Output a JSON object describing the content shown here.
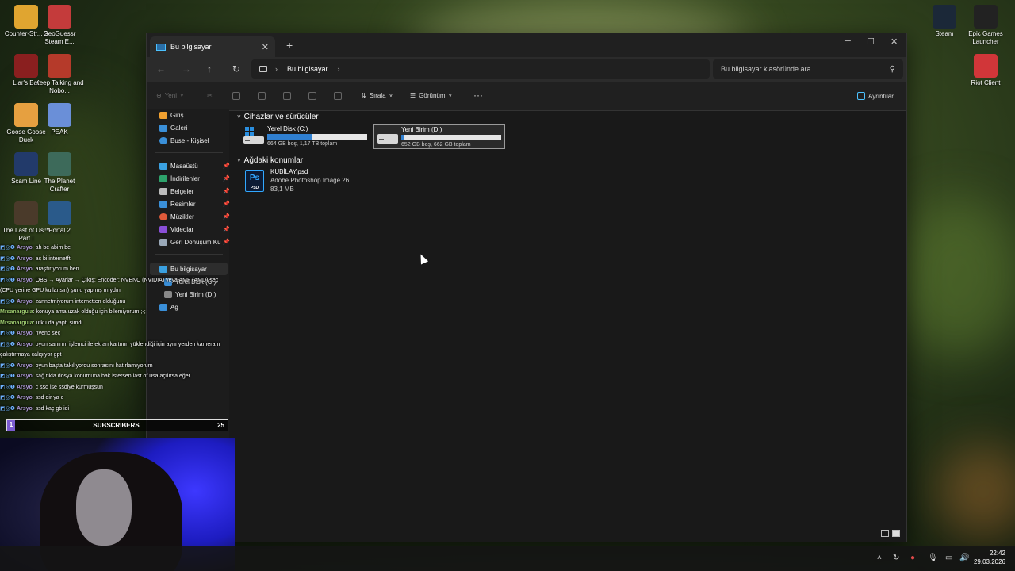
{
  "desktop": {
    "left_icons": [
      {
        "label": "Counter-Str... 2",
        "icon": "cs2-icon",
        "color": "#e0a530"
      },
      {
        "label": "GeoGuessr Steam E...",
        "icon": "geoguessr-icon",
        "color": "#c43b3b"
      },
      {
        "label": "Liar's Bar",
        "icon": "liars-bar-icon",
        "color": "#8a1f1f"
      },
      {
        "label": "Keep Talking and Nobo...",
        "icon": "keep-talking-icon",
        "color": "#b53a2a"
      },
      {
        "label": "Goose Goose Duck",
        "icon": "goose-goose-duck-icon",
        "color": "#e6a040"
      },
      {
        "label": "PEAK",
        "icon": "peak-icon",
        "color": "#6a8fd8"
      },
      {
        "label": "Scam Line",
        "icon": "scam-line-icon",
        "color": "#223a6a"
      },
      {
        "label": "The Planet Crafter",
        "icon": "planet-crafter-icon",
        "color": "#3d6a5a"
      },
      {
        "label": "The Last of Us™ Part I",
        "icon": "last-of-us-icon",
        "color": "#4a3a2a"
      },
      {
        "label": "Portal 2",
        "icon": "portal-2-icon",
        "color": "#2a5a8a"
      }
    ],
    "right_icons": [
      {
        "label": "Steam",
        "icon": "steam-icon",
        "color": "#1b2838"
      },
      {
        "label": "Epic Games Launcher",
        "icon": "epic-games-icon",
        "color": "#222222"
      },
      {
        "label": "Riot Client",
        "icon": "riot-client-icon",
        "color": "#d13639"
      }
    ]
  },
  "window": {
    "tab_title": "Bu bilgisayar",
    "breadcrumb": "Bu bilgisayar",
    "search_placeholder": "Bu bilgisayar klasöründe ara",
    "toolbar": {
      "new": "Yeni",
      "sort": "Sırala",
      "view": "Görünüm",
      "more": "···",
      "details": "Ayrıntılar"
    },
    "sidebar": {
      "top": [
        "Giriş",
        "Galeri",
        "Buse - Kişisel"
      ],
      "pinned": [
        "Masaüstü",
        "İndirilenler",
        "Belgeler",
        "Resimler",
        "Müzikler",
        "Videolar",
        "Geri Dönüşüm Ku"
      ],
      "this_pc": "Bu bilgisayar",
      "drives": [
        "Yerel Disk (C:)",
        "Yeni Birim (D:)"
      ],
      "network": "Ağ"
    },
    "groups": {
      "devices": "Cihazlar ve sürücüler",
      "network_locations": "Ağdaki konumlar"
    },
    "drives": [
      {
        "name": "Yerel Disk (C:)",
        "capacity": "664 GB boş, 1,17 TB toplam",
        "used_fraction": 0.45,
        "selected": false
      },
      {
        "name": "Yeni Birim (D:)",
        "capacity": "652 GB boş, 662 GB toplam",
        "used_fraction": 0.02,
        "selected": true
      }
    ],
    "file": {
      "name": "KUBİLAY.psd",
      "type": "Adobe Photoshop Image.26",
      "size": "83,1 MB",
      "icon_text": "Ps",
      "icon_sub": "PSD"
    }
  },
  "chat": [
    {
      "user": "Arsyo",
      "text": ": ah be abim be"
    },
    {
      "user": "Arsyo",
      "text": ": aç bi internetft"
    },
    {
      "user": "Arsyo",
      "text": ": araştırıyorum ben"
    },
    {
      "user": "Arsyo",
      "text": ": OBS → Ayarlar → Çıkış: Encoder: NVENC (NVIDIA) veya AMF (AMD) seç (CPU yerine GPU kullansın) şunu yapmış mıydın"
    },
    {
      "user": "Arsyo",
      "text": ": zannetmiyorum internetten olduğunu"
    },
    {
      "user": "Mrsanarguia",
      "text": ": konuya ama uzak olduğu için bilemiyorum ;-;"
    },
    {
      "user": "Mrsanarguia",
      "text": ": utku da yaptı şimdi"
    },
    {
      "user": "Arsyo",
      "text": ": nvenc seç"
    },
    {
      "user": "Arsyo",
      "text": ": oyun sanırım işlemci ile ekran kartının yüklendiği için aynı yerden kameranı çalıştırmaya çalışıyor gpt"
    },
    {
      "user": "Arsyo",
      "text": ": oyun başta takılıyordu sonrasını hatırlamıyorum"
    },
    {
      "user": "Arsyo",
      "text": ": sağ tıkla dosya konumuna bak istersen last of usa açılırsa eğer"
    },
    {
      "user": "Arsyo",
      "text": ": c ssd ise ssdiye kurmuşsun"
    },
    {
      "user": "Arsyo",
      "text": ": ssd dir ya c"
    },
    {
      "user": "Arsyo",
      "text": ": ssd kaç gb idi"
    }
  ],
  "subs_bar": {
    "left": "1",
    "label": "SUBSCRIBERS",
    "right": "25"
  },
  "taskbar": {
    "time": "22:42",
    "date": "29.03.2026"
  }
}
